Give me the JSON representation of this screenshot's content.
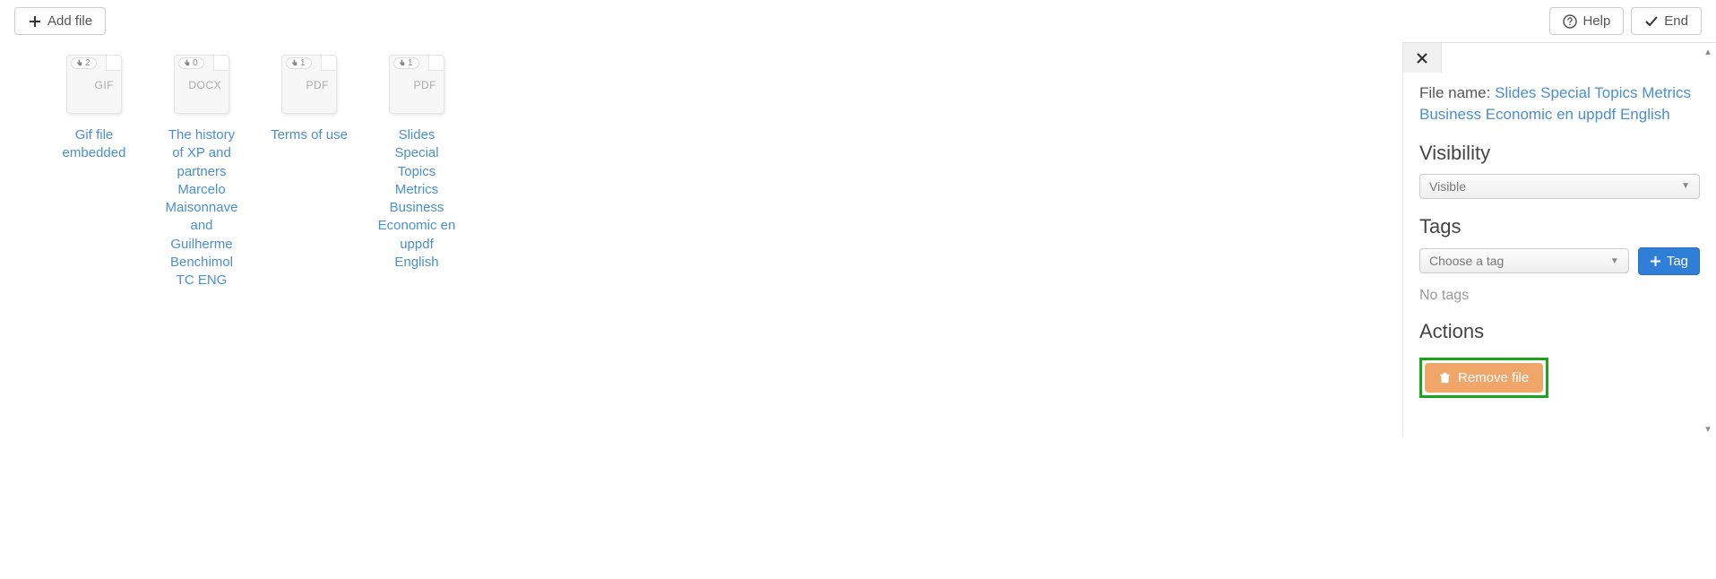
{
  "toolbar": {
    "add_file": "Add file",
    "help": "Help",
    "end": "End"
  },
  "files": [
    {
      "ext": "GIF",
      "count": "2",
      "title": "Gif file embedded"
    },
    {
      "ext": "DOCX",
      "count": "0",
      "title": "The history of XP and partners Marcelo Maisonnave and Guilherme Benchimol TC ENG"
    },
    {
      "ext": "PDF",
      "count": "1",
      "title": "Terms of use"
    },
    {
      "ext": "PDF",
      "count": "1",
      "title": "Slides Special Topics Metrics Business Economic en uppdf English"
    }
  ],
  "side": {
    "filename_label": "File name: ",
    "filename_value": "Slides Special Topics Metrics Business Economic en uppdf English",
    "visibility_h": "Visibility",
    "visibility_value": "Visible",
    "tags_h": "Tags",
    "tags_placeholder": "Choose a tag",
    "tag_btn": "Tag",
    "notags": "No tags",
    "actions_h": "Actions",
    "remove": "Remove file"
  }
}
